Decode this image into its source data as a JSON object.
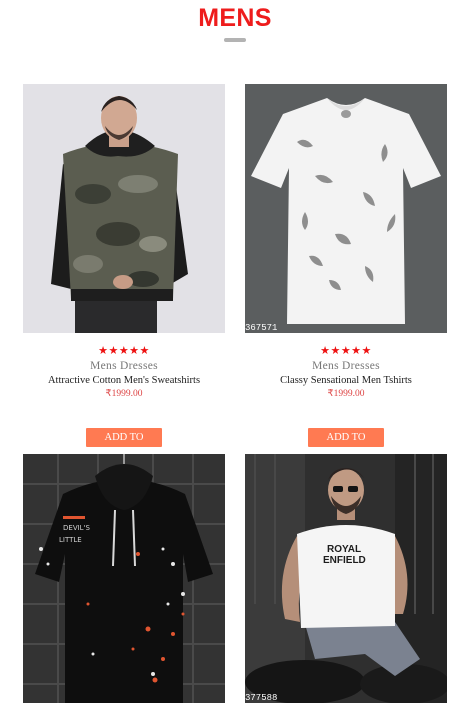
{
  "section": {
    "title": "MENS"
  },
  "products": [
    {
      "rating_stars": "★★★★★",
      "category": "Mens Dresses",
      "name": "Attractive Cotton Men's Sweatshirts",
      "price": "₹1999.00",
      "cart_label": "ADD TO CART"
    },
    {
      "rating_stars": "★★★★★",
      "category": "Mens Dresses",
      "name": "Classy Sensational Men Tshirts",
      "price": "₹1999.00",
      "cart_label": "ADD TO CART",
      "image_code": "367571"
    },
    {
      "image_code": ""
    },
    {
      "image_code": "377588",
      "shirt_text_1": "ROYAL",
      "shirt_text_2": "ENFIELD"
    }
  ],
  "colors": {
    "title": "#ee1c1c",
    "stars": "#ee1111",
    "price": "#dd4444",
    "button": "#ff7a52"
  }
}
